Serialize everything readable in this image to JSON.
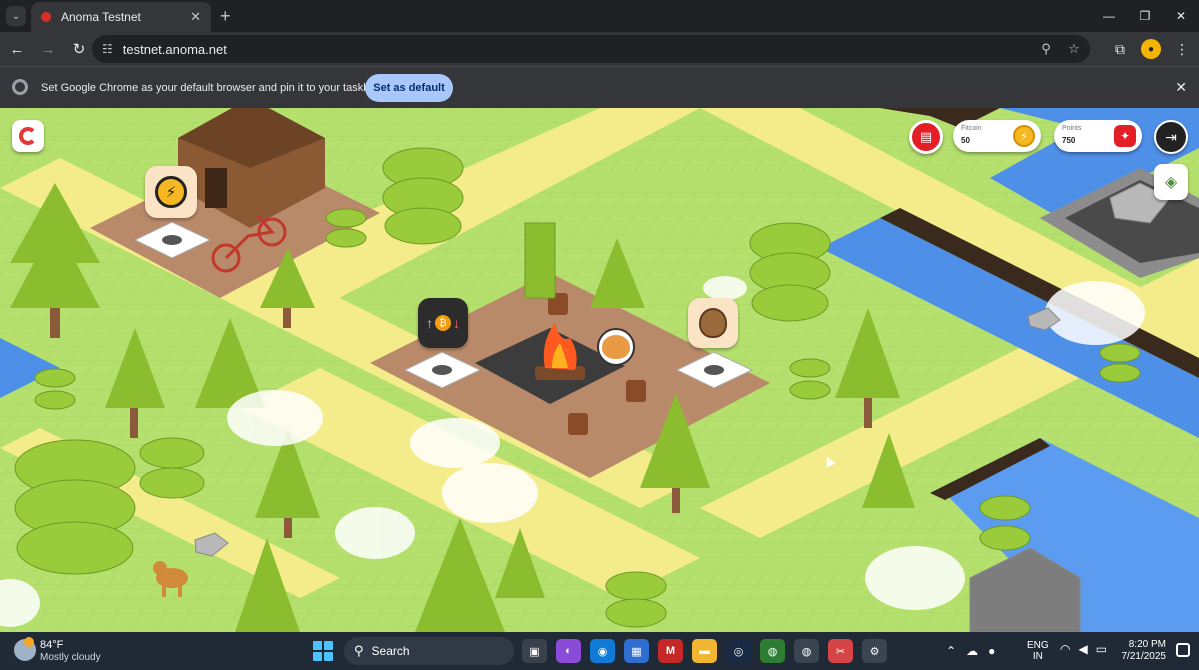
{
  "browser": {
    "tab_title": "Anoma Testnet",
    "tab_close": "✕",
    "new_tab": "+",
    "url": "testnet.anoma.net",
    "infobar_text": "Set Google Chrome as your default browser and pin it to your taskbar",
    "infobar_button": "Set as default",
    "infobar_close": "✕"
  },
  "window_controls": {
    "minimize": "—",
    "maximize": "❐",
    "close": "✕"
  },
  "hud": {
    "fitcoin_label": "Fitcoin",
    "fitcoin_value": "50",
    "points_label": "Points",
    "points_value": "750"
  },
  "taskbar": {
    "temperature": "84°F",
    "weather": "Mostly cloudy",
    "search_label": "Search",
    "language": "ENG",
    "region": "IN",
    "time": "8:20 PM",
    "date": "7/21/2025"
  },
  "icons": {
    "coin": "lightning-coin-icon",
    "points": "star-badge-icon",
    "exit": "logout-icon",
    "layers": "layers-icon",
    "map_stations": [
      "lightning-coin-icon",
      "token-swap-icon",
      "acorn-icon"
    ]
  },
  "colors": {
    "grass": "#b5e06e",
    "path": "#f4ec8a",
    "dirt": "#b98a6a",
    "water": "#4e8fe8",
    "accent_red": "#e41e26",
    "infobar_button": "#a8c7fa"
  }
}
